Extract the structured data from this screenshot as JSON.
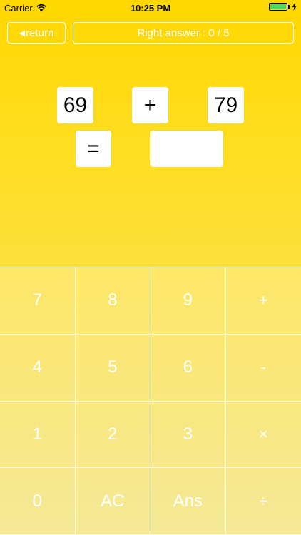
{
  "status_bar": {
    "carrier": "Carrier",
    "time": "10:25 PM",
    "battery_color": "#4CD964"
  },
  "nav": {
    "return_label": "return",
    "return_icon": "left-triangle-icon",
    "score_text": "Right answer : 0 / 5"
  },
  "equation": {
    "left_operand": "69",
    "operator": "+",
    "right_operand": "79",
    "equals": "=",
    "answer": ""
  },
  "keypad": {
    "keys": [
      {
        "label": "7",
        "name": "key-7"
      },
      {
        "label": "8",
        "name": "key-8"
      },
      {
        "label": "9",
        "name": "key-9"
      },
      {
        "label": "+",
        "name": "key-plus"
      },
      {
        "label": "4",
        "name": "key-4"
      },
      {
        "label": "5",
        "name": "key-5"
      },
      {
        "label": "6",
        "name": "key-6"
      },
      {
        "label": "-",
        "name": "key-minus"
      },
      {
        "label": "1",
        "name": "key-1"
      },
      {
        "label": "2",
        "name": "key-2"
      },
      {
        "label": "3",
        "name": "key-3"
      },
      {
        "label": "×",
        "name": "key-multiply"
      },
      {
        "label": "0",
        "name": "key-0"
      },
      {
        "label": "AC",
        "name": "key-clear"
      },
      {
        "label": "Ans",
        "name": "key-answer"
      },
      {
        "label": "÷",
        "name": "key-divide"
      }
    ]
  },
  "colors": {
    "background_top": "#FFD700",
    "background_bottom": "#F3E37A",
    "accent": "#FFFFFF"
  }
}
